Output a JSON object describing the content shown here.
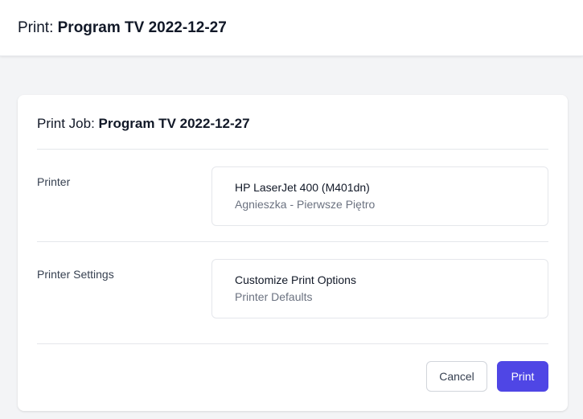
{
  "header": {
    "prefix": "Print: ",
    "document": "Program TV 2022-12-27"
  },
  "card": {
    "title_prefix": "Print Job: ",
    "title_document": "Program TV 2022-12-27"
  },
  "printer": {
    "label": "Printer",
    "name": "HP LaserJet 400 (M401dn)",
    "location": "Agnieszka - Pierwsze Piętro"
  },
  "settings": {
    "label": "Printer Settings",
    "title": "Customize Print Options",
    "value": "Printer Defaults"
  },
  "actions": {
    "cancel_label": "Cancel",
    "print_label": "Print"
  },
  "colors": {
    "primary": "#4f46e5",
    "background": "#f3f4f6"
  }
}
